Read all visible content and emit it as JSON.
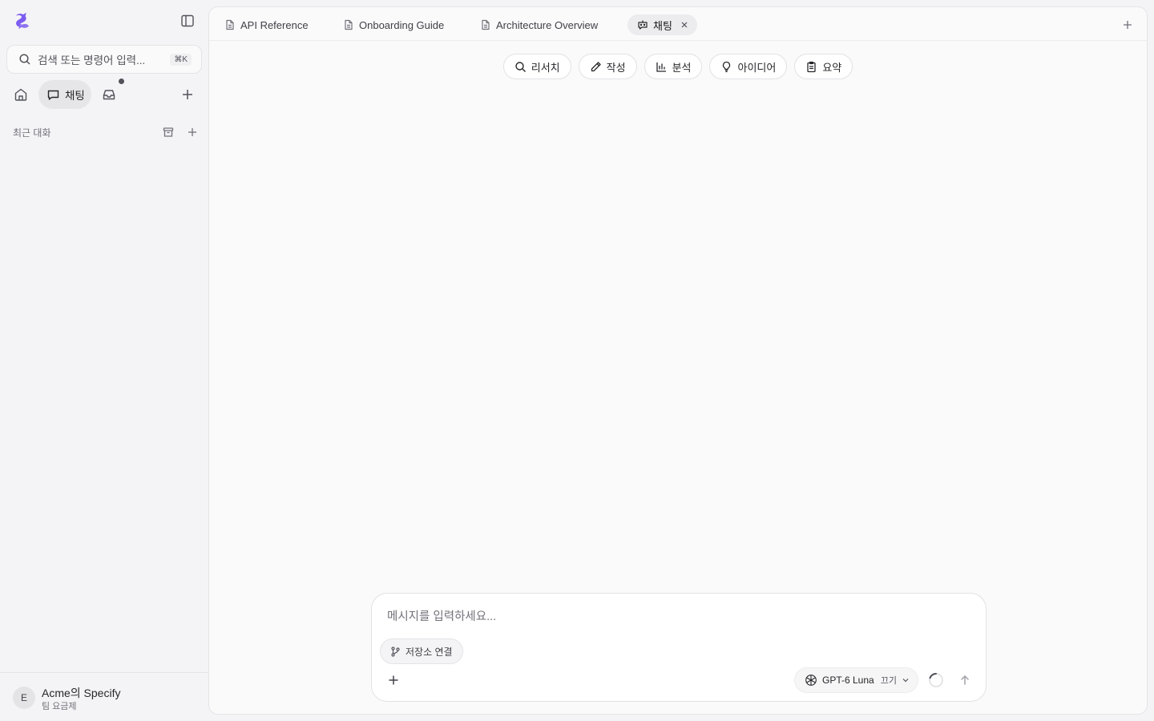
{
  "colors": {
    "brand": "#7c5cf0",
    "sidebar_bg": "#f4f4f6",
    "main_bg": "#fafafb",
    "border": "#e4e4e7"
  },
  "sidebar": {
    "logo_icon": "specify-logo-icon",
    "collapse_icon": "sidebar-toggle-icon",
    "search": {
      "placeholder": "검색 또는 명령어 입력...",
      "shortcut": "⌘K"
    },
    "nav": {
      "home_icon": "home-icon",
      "chat_label": "채팅",
      "inbox_icon": "inbox-icon",
      "inbox_has_unread": true
    },
    "recent": {
      "label": "최근 대화",
      "items": []
    },
    "footer": {
      "avatar_initial": "E",
      "org_name": "Acme의 Specify",
      "plan": "팀 요금제"
    }
  },
  "tabs": [
    {
      "label": "API Reference",
      "icon": "document-icon",
      "active": false
    },
    {
      "label": "Onboarding Guide",
      "icon": "document-icon",
      "active": false
    },
    {
      "label": "Architecture Overview",
      "icon": "document-icon",
      "active": false
    },
    {
      "label": "채팅",
      "icon": "bot-icon",
      "active": true,
      "closable": true
    }
  ],
  "quick_actions": [
    {
      "label": "리서치",
      "icon": "search-icon"
    },
    {
      "label": "작성",
      "icon": "pencil-icon"
    },
    {
      "label": "분석",
      "icon": "bar-chart-icon"
    },
    {
      "label": "아이디어",
      "icon": "lightbulb-icon"
    },
    {
      "label": "요약",
      "icon": "clipboard-icon"
    }
  ],
  "composer": {
    "placeholder": "메시지를 입력하세요...",
    "repo_button": "저장소 연결",
    "model": "GPT-6 Luna",
    "model_mode": "끄기",
    "model_icon": "openai-icon"
  }
}
